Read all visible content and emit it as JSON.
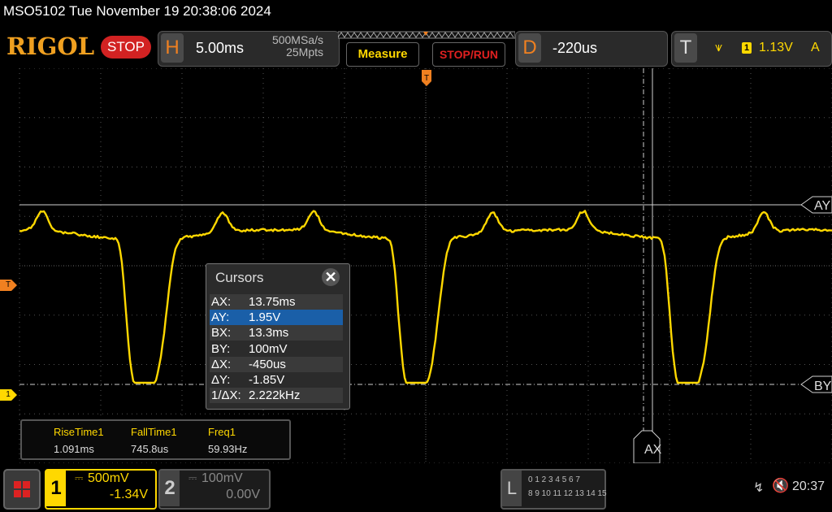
{
  "status": {
    "text": "MSO5102  Tue November 19 20:38:06 2024"
  },
  "logo": "RIGOL",
  "run_state": "STOP",
  "horizontal": {
    "letter": "H",
    "timebase": "5.00ms",
    "sample_rate": "500MSa/s",
    "memory_depth": "25Mpts"
  },
  "buttons": {
    "measure": "Measure",
    "stop_run": "STOP/RUN"
  },
  "delay": {
    "letter": "D",
    "value": "-220us"
  },
  "trigger": {
    "letter": "T",
    "slope": "⩛",
    "source": "1",
    "level": "1.13V",
    "mode": "A"
  },
  "markers": {
    "trigger_left": "T",
    "ch1_ground": "1",
    "trigger_top": "T"
  },
  "cursor_tags": {
    "ay": "AY",
    "by": "BY",
    "ax": "AX"
  },
  "cursors": {
    "title": "Cursors",
    "close": "✕",
    "rows": [
      {
        "k": "AX:",
        "v": "13.75ms"
      },
      {
        "k": "AY:",
        "v": "1.95V"
      },
      {
        "k": "BX:",
        "v": "13.3ms"
      },
      {
        "k": "BY:",
        "v": "100mV"
      },
      {
        "k": "ΔX:",
        "v": "-450us"
      },
      {
        "k": "ΔY:",
        "v": "-1.85V"
      },
      {
        "k": "1/ΔX:",
        "v": "2.222kHz"
      }
    ]
  },
  "measurements": [
    {
      "name": "RiseTime1",
      "value": "1.091ms"
    },
    {
      "name": "FallTime1",
      "value": "745.8us"
    },
    {
      "name": "Freq1",
      "value": "59.93Hz"
    }
  ],
  "channels": [
    {
      "num": "1",
      "coupling": "⎓",
      "scale": "500mV",
      "offset": "-1.34V",
      "active": true
    },
    {
      "num": "2",
      "coupling": "⎓",
      "scale": "100mV",
      "offset": "0.00V",
      "active": false
    }
  ],
  "logic": {
    "letter": "L",
    "row1": "0 1 2 3  4 5 6 7",
    "row2": "8 9 10 11 12 13 14 15"
  },
  "system": {
    "usb_icon": "↯",
    "speaker_icon": "🔇",
    "time": "20:37"
  },
  "colors": {
    "ch1": "#ffd800",
    "accent": "#f08020",
    "stop": "#d22222",
    "selection": "#1a5fa8"
  }
}
